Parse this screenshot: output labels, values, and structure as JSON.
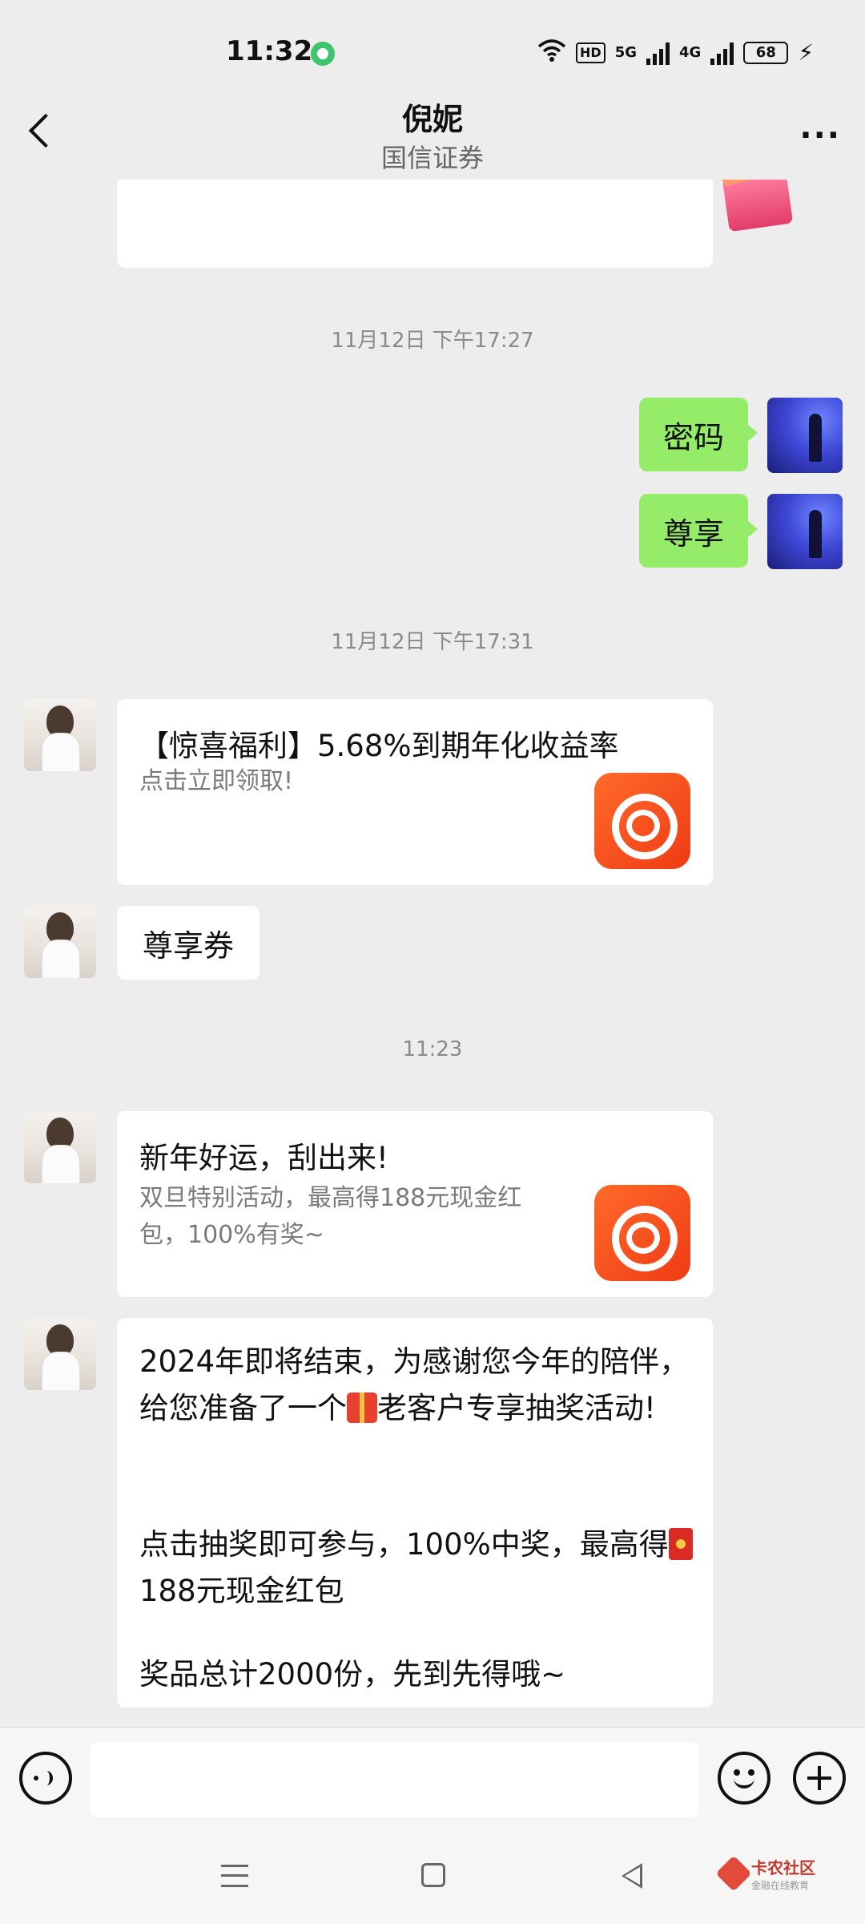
{
  "status": {
    "time": "11:32",
    "hd": "HD",
    "net_5g": "5G",
    "net_4g": "4G",
    "battery": "68"
  },
  "header": {
    "title": "倪妮",
    "subtitle": "国信证券"
  },
  "messages": {
    "time1": "11月12日 下午17:27",
    "my_msg1": "密码",
    "my_msg2": "尊享",
    "time2": "11月12日 下午17:31",
    "card1_title": "【惊喜福利】5.68%到期年化收益率",
    "card1_desc": "点击立即领取!",
    "msg_coupon": "尊享券",
    "time3": "11:23",
    "card2_title": "新年好运，刮出来!",
    "card2_desc": "双旦特别活动，最高得188元现金红包，100%有奖~",
    "long_part1": "2024年即将结束，为感谢您今年的陪伴，给您准备了一个",
    "long_part2": "老客户专享抽奖活动!",
    "long_part3": "点击抽奖即可参与，100%中奖，最高得",
    "long_part4": "188元现金红包",
    "long_part5": "奖品总计2000份，先到先得哦~"
  },
  "watermark": {
    "title": "卡农社区",
    "subtitle": "金融在线教育"
  },
  "icons": {
    "back": "back-arrow-icon",
    "more": "more-icon",
    "voice": "voice-icon",
    "emoji": "emoji-icon",
    "plus": "plus-icon"
  },
  "colors": {
    "my_bubble": "#95ec69",
    "app_logo": "#ef3b14",
    "background": "#ededed"
  }
}
